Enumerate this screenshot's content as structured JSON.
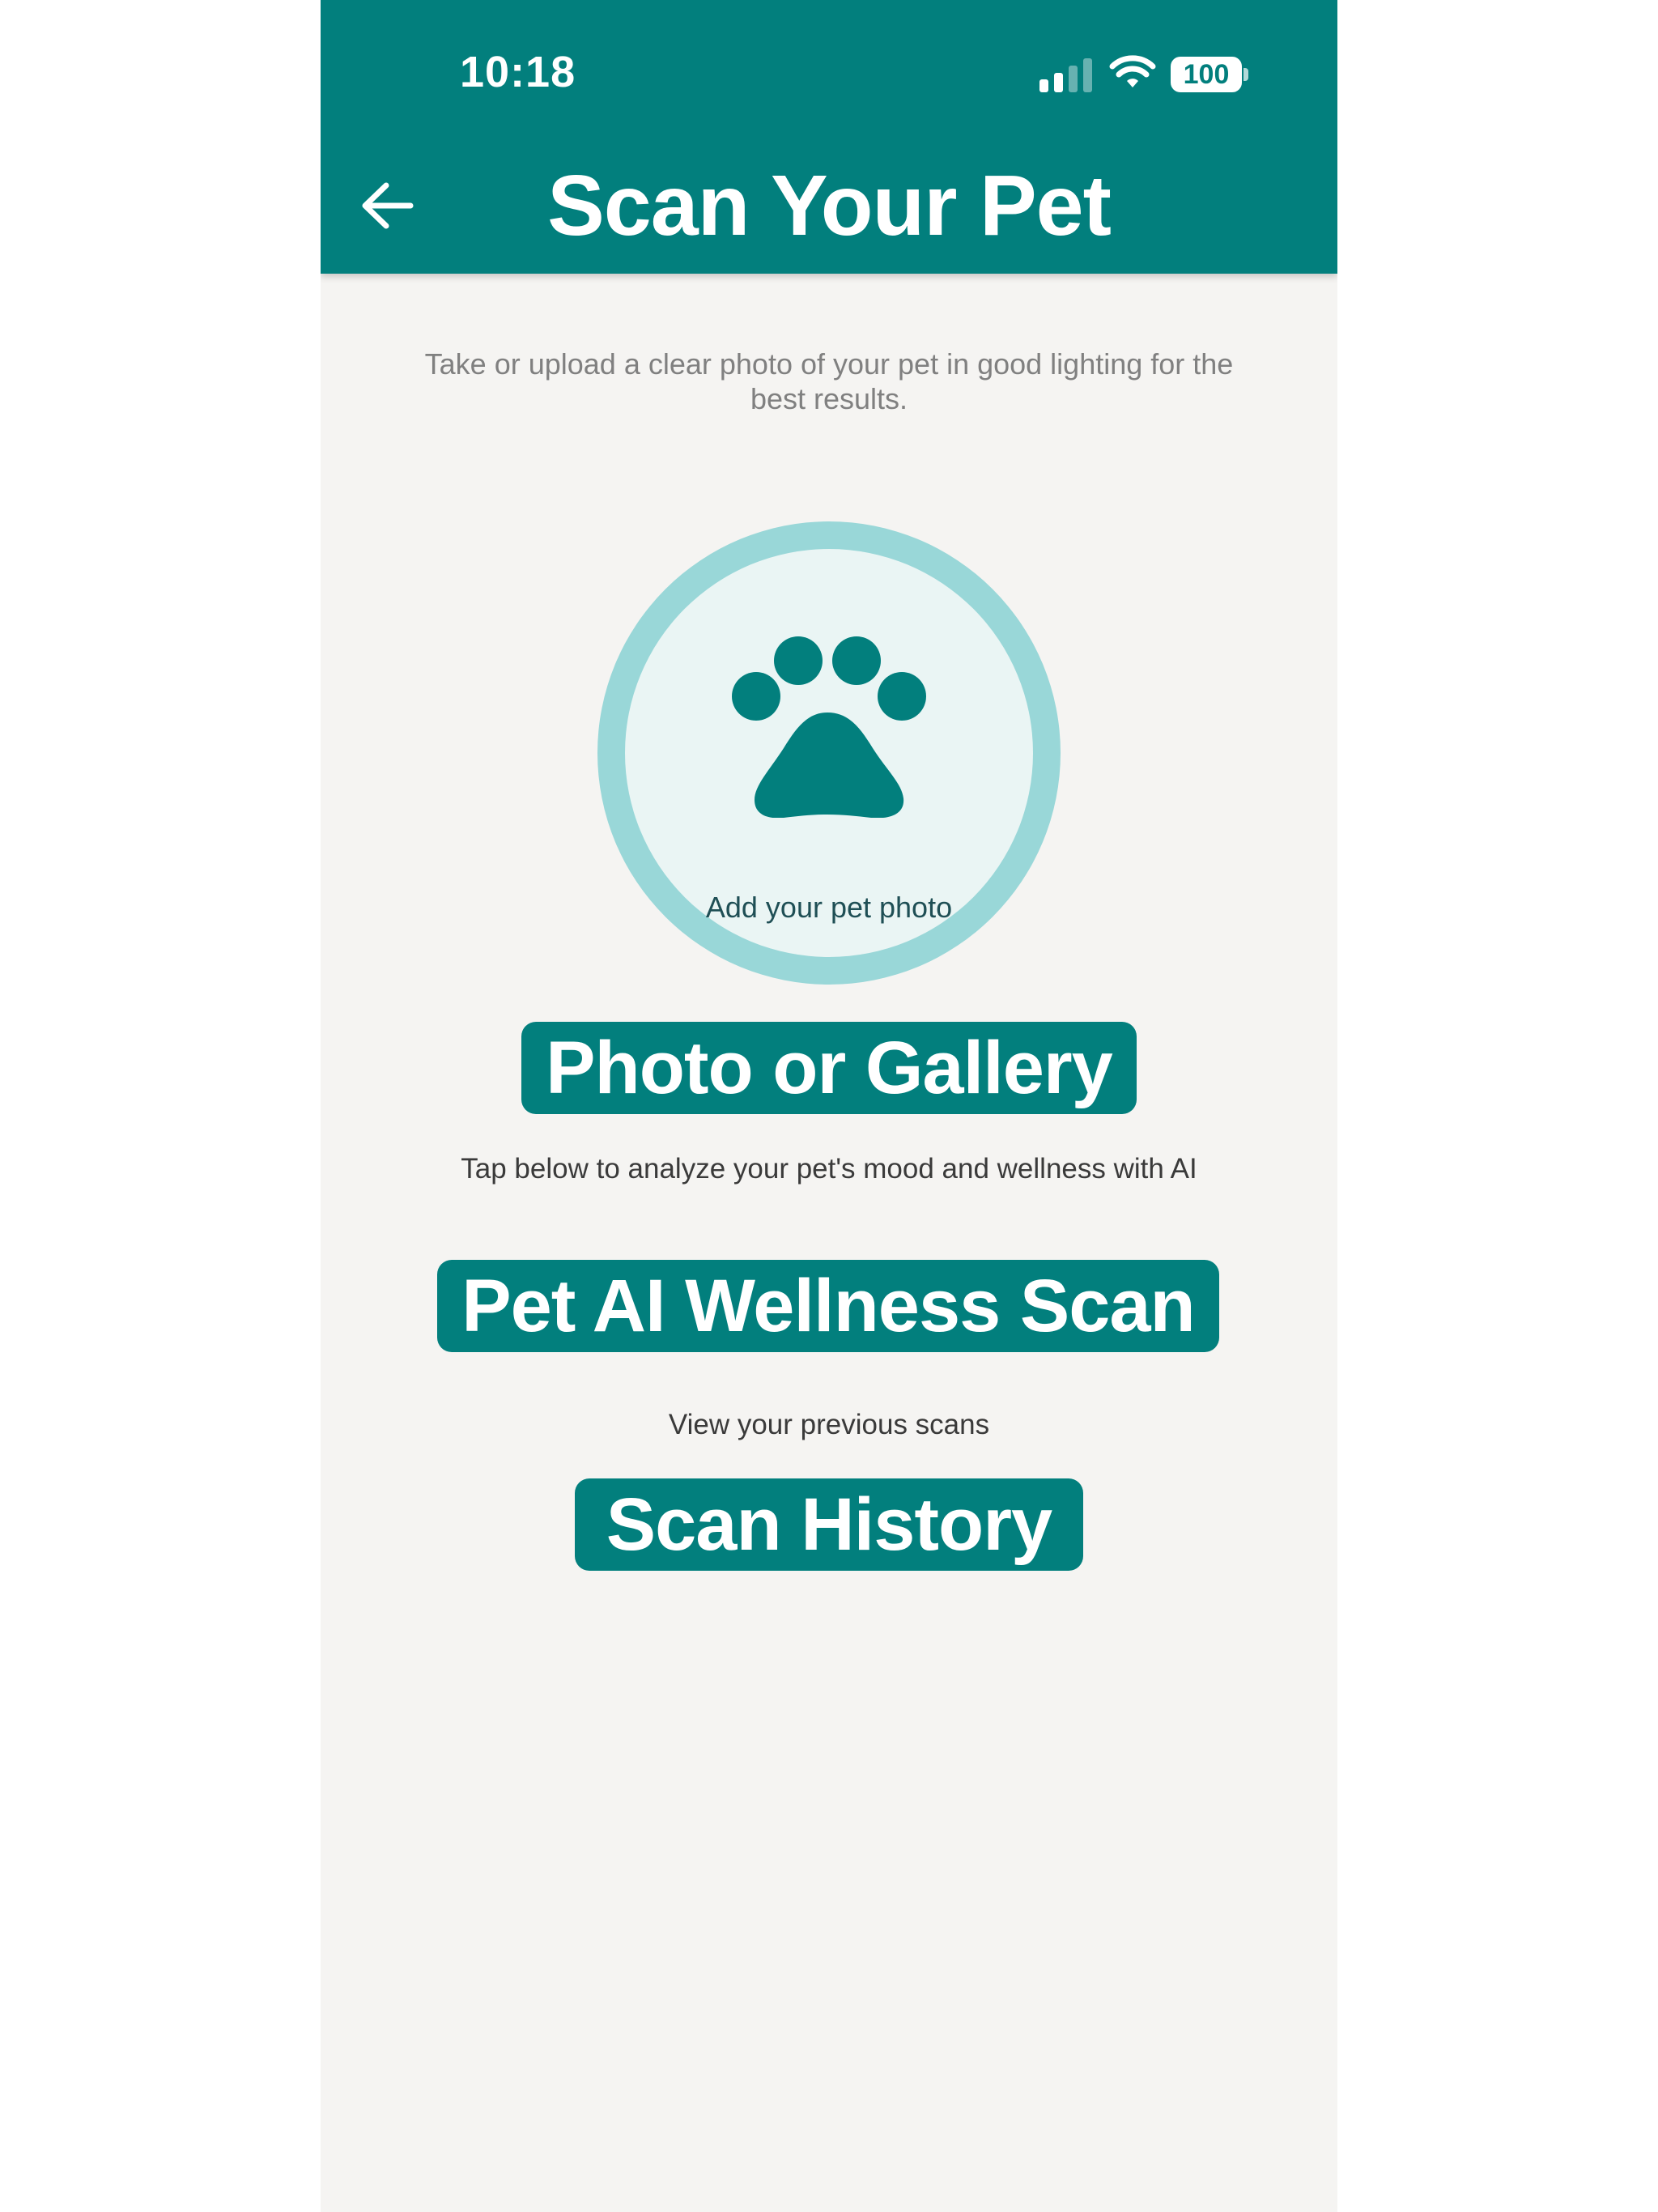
{
  "status_bar": {
    "time": "10:18",
    "battery": "100"
  },
  "header": {
    "title": "Scan Your Pet",
    "back_icon": "arrow-left-icon"
  },
  "main": {
    "instructions": "Take or upload a clear photo of your pet in good lighting for the best results.",
    "photo_placeholder": {
      "icon": "paw-icon",
      "label": "Add your pet photo"
    },
    "photo_button_label": "Photo or Gallery",
    "analyze_hint": "Tap below to analyze your pet's mood and wellness with AI",
    "wellness_button_label": "Pet AI Wellness Scan",
    "history_hint": "View your previous scans",
    "history_button_label": "Scan History"
  },
  "colors": {
    "primary": "#027f7d",
    "circle_ring": "#99d7d8",
    "circle_fill": "#eaf5f4",
    "background": "#f5f4f2"
  }
}
